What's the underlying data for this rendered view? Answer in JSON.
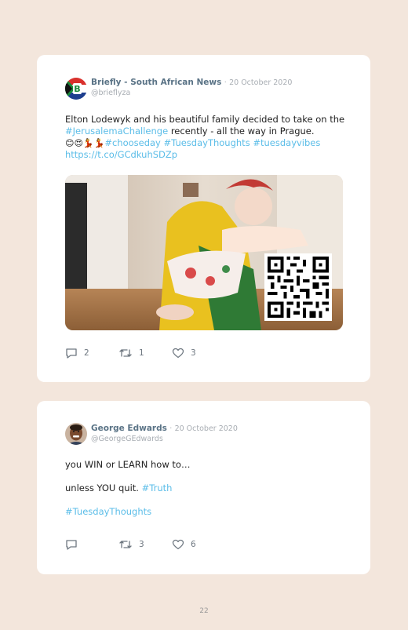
{
  "tweets": [
    {
      "author": "Briefly - South African News",
      "separator": "·",
      "date": "20 October 2020",
      "handle": "@brieflyza",
      "text_1": "Elton Lodewyk and his beautiful family decided to take on the ",
      "hashtag_1": "#JerusalemaChallenge",
      "text_2": " recently - all the way in Prague.",
      "emojis": "😊😍💃💃",
      "hashtag_2": "#chooseday",
      "hashtag_3": "#TuesdayThoughts",
      "hashtag_4": "#tuesdayvibes",
      "link": "https://t.co/GCdkuhSDZp",
      "replies": "2",
      "retweets": "1",
      "likes": "3"
    },
    {
      "author": "George Edwards",
      "separator": "·",
      "date": "20 October 2020",
      "handle": "@GeorgeGEdwards",
      "line_1": "you WIN or LEARN how to…",
      "line_2_text": "unless YOU quit. ",
      "line_2_hashtag": "#Truth",
      "line_3_hashtag": "#TuesdayThoughts",
      "replies": "",
      "retweets": "3",
      "likes": "6"
    }
  ],
  "page_number": "22",
  "icons": [
    "reply-icon",
    "retweet-icon",
    "like-icon",
    "qr-code-icon"
  ],
  "colors": {
    "background": "#f3e6dc",
    "card": "#ffffff",
    "name": "#5a7386",
    "link": "#5bbde8",
    "muted": "#a8adb3"
  }
}
